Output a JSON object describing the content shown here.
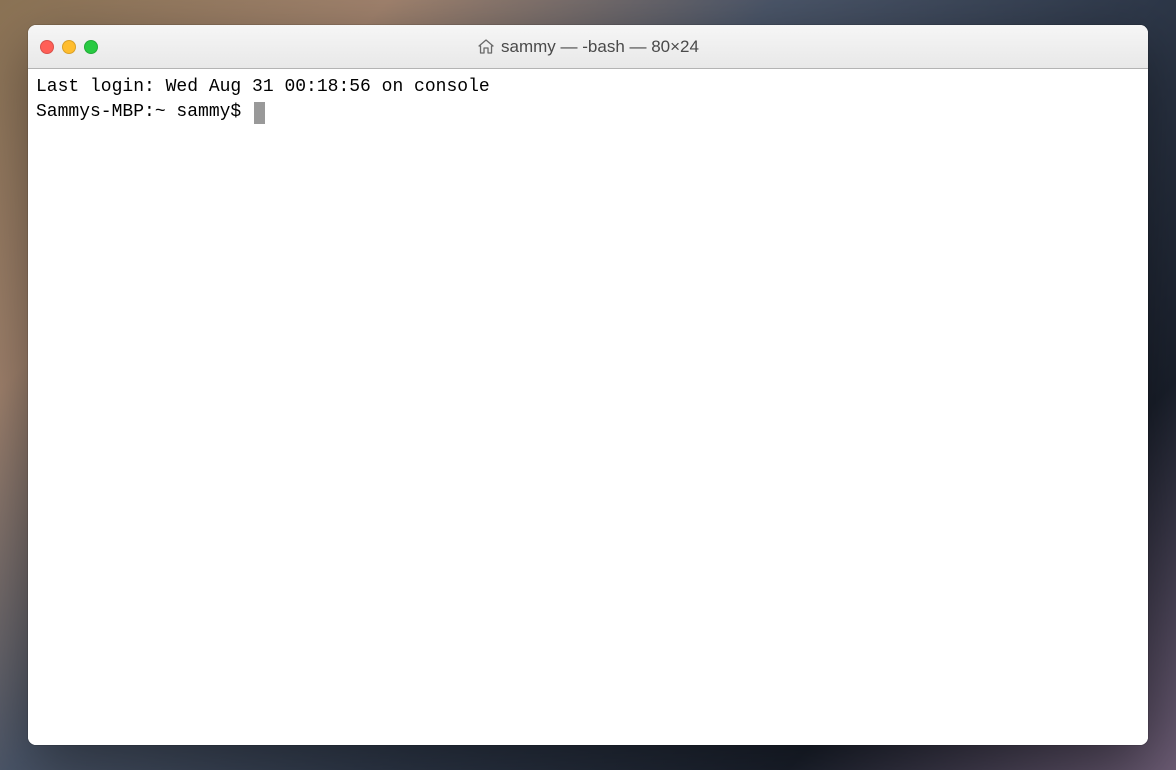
{
  "window": {
    "title": "sammy — -bash — 80×24"
  },
  "terminal": {
    "last_login": "Last login: Wed Aug 31 00:18:56 on console",
    "prompt": "Sammys-MBP:~ sammy$ "
  }
}
